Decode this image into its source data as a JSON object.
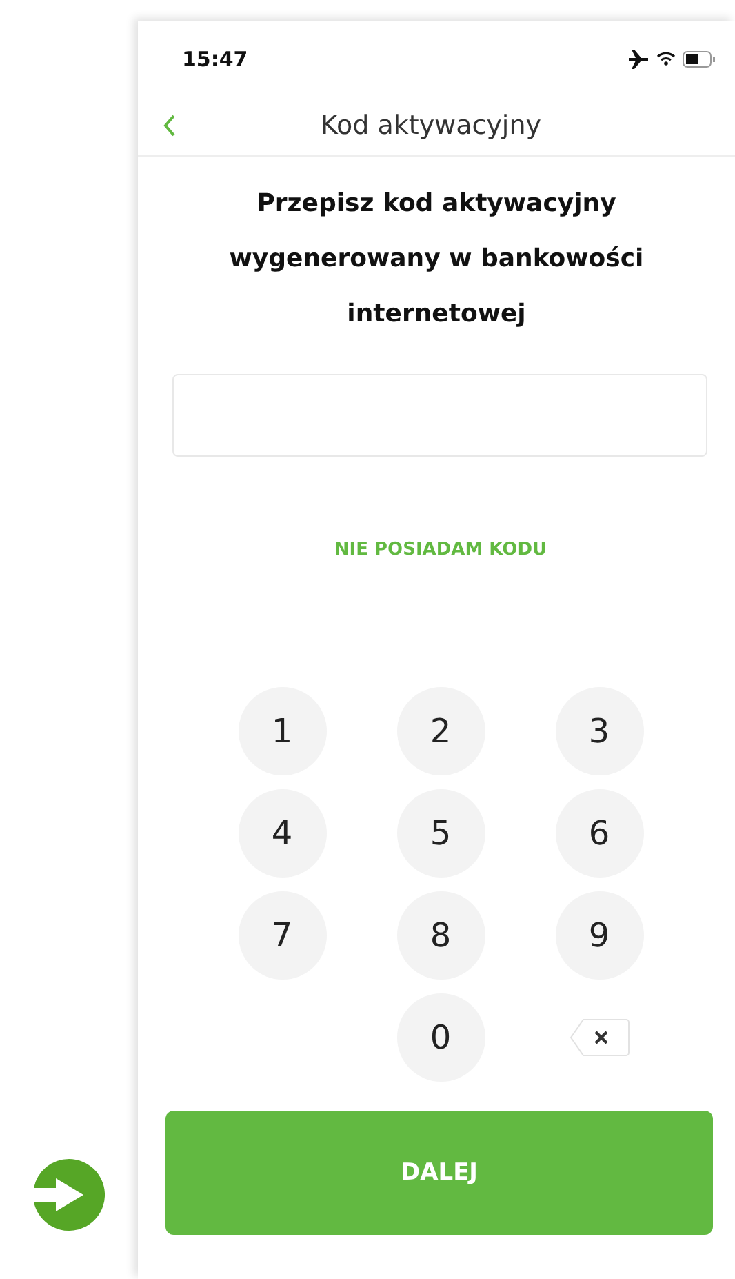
{
  "status_bar": {
    "time": "15:47"
  },
  "header": {
    "title": "Kod aktywacyjny"
  },
  "heading": "Przepisz kod aktywacyjny wygenerowany w bankowości internetowej",
  "no_code_link": "NIE POSIADAM KODU",
  "keypad": [
    {
      "kind": "digit",
      "label": "1"
    },
    {
      "kind": "digit",
      "label": "2"
    },
    {
      "kind": "digit",
      "label": "3"
    },
    {
      "kind": "digit",
      "label": "4"
    },
    {
      "kind": "digit",
      "label": "5"
    },
    {
      "kind": "digit",
      "label": "6"
    },
    {
      "kind": "digit",
      "label": "7"
    },
    {
      "kind": "digit",
      "label": "8"
    },
    {
      "kind": "digit",
      "label": "9"
    },
    {
      "kind": "blank"
    },
    {
      "kind": "digit",
      "label": "0"
    },
    {
      "kind": "backspace"
    }
  ],
  "next_button": "DALEJ"
}
